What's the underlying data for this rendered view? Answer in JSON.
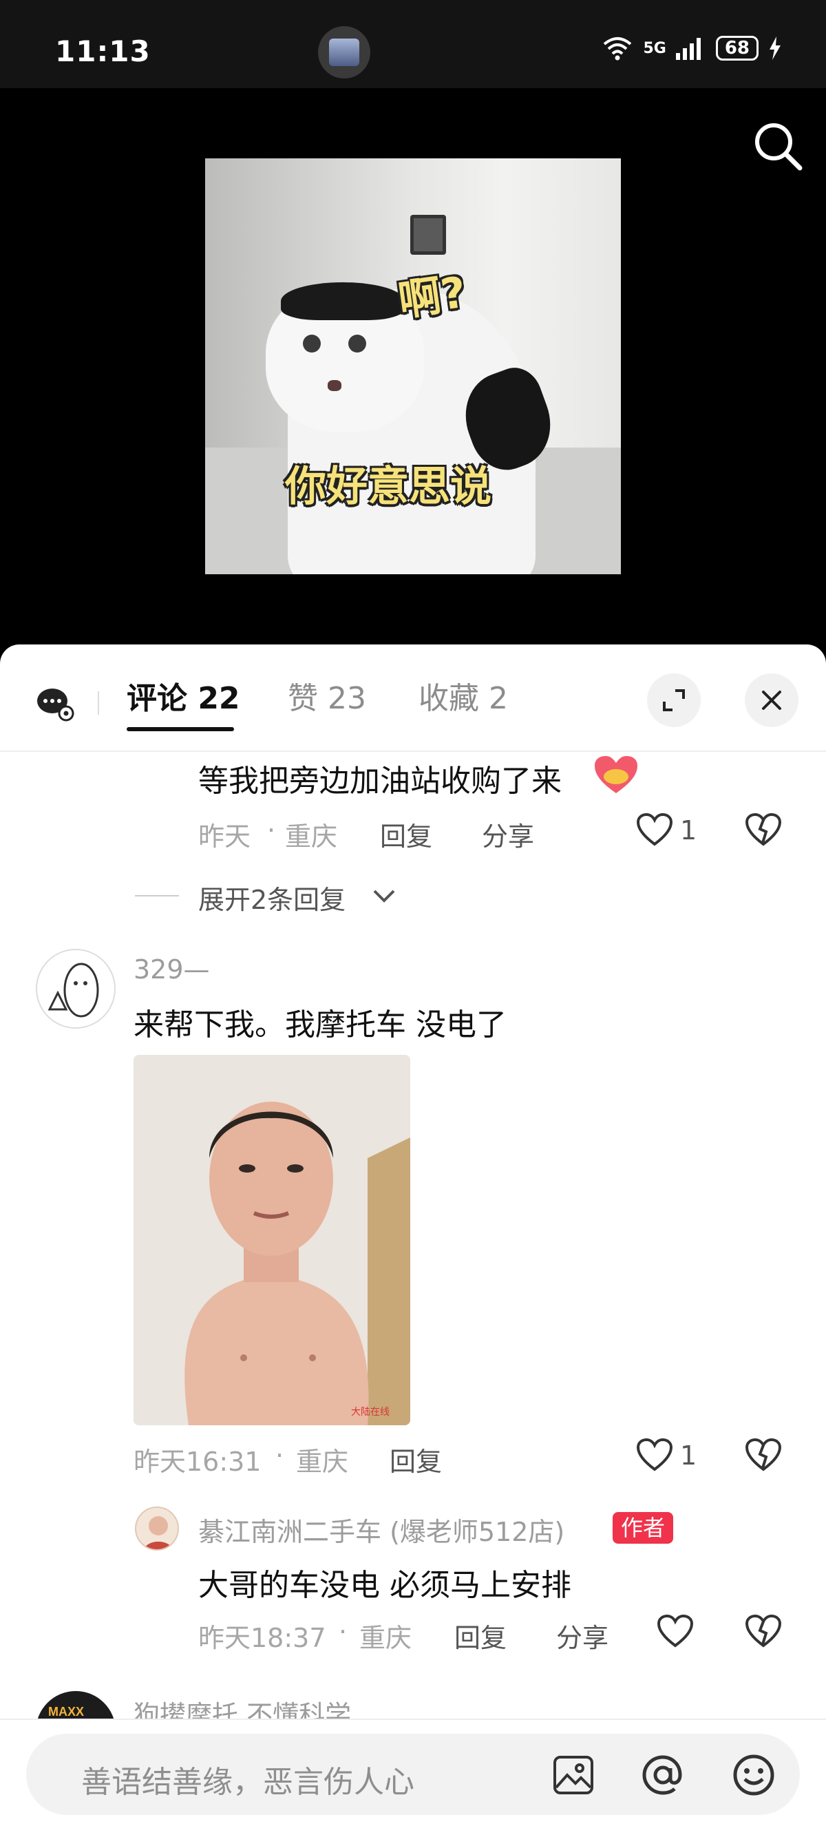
{
  "status_bar": {
    "time": "11:13",
    "network": "5G",
    "battery": "68"
  },
  "video": {
    "caption_top": "啊?",
    "caption_bottom": "你好意思说"
  },
  "tabs": {
    "comments": "评论 22",
    "likes": "赞 23",
    "favorites": "收藏 2"
  },
  "comments": [
    {
      "text": "等我把旁边加油站收购了来",
      "meta_time": "昨天",
      "meta_sep": "·",
      "meta_location": "重庆",
      "reply_label": "回复",
      "share_label": "分享",
      "like_count": "1"
    }
  ],
  "expand_replies": "展开2条回复",
  "comment2": {
    "username": "329—",
    "text": "来帮下我。我摩托车 没电了",
    "meta_time": "昨天16:31",
    "meta_sep": "·",
    "meta_location": "重庆",
    "reply_label": "回复",
    "like_count": "1",
    "photo_watermark": "大陆在线"
  },
  "reply": {
    "username": "綦江南洲二手车 (爆老师512店)",
    "badge": "作者",
    "text": "大哥的车没电  必须马上安排",
    "meta_time": "昨天18:37",
    "meta_sep": "·",
    "meta_location": "重庆",
    "reply_label": "回复",
    "share_label": "分享"
  },
  "next_comment": {
    "username": "狗撵摩托 不懂科学",
    "avatar_text": "MAXX"
  },
  "input": {
    "placeholder": "善语结善缘，恶言伤人心"
  },
  "colors": {
    "accent_badge": "#f0334b",
    "caption_yellow": "#f6e27a"
  }
}
